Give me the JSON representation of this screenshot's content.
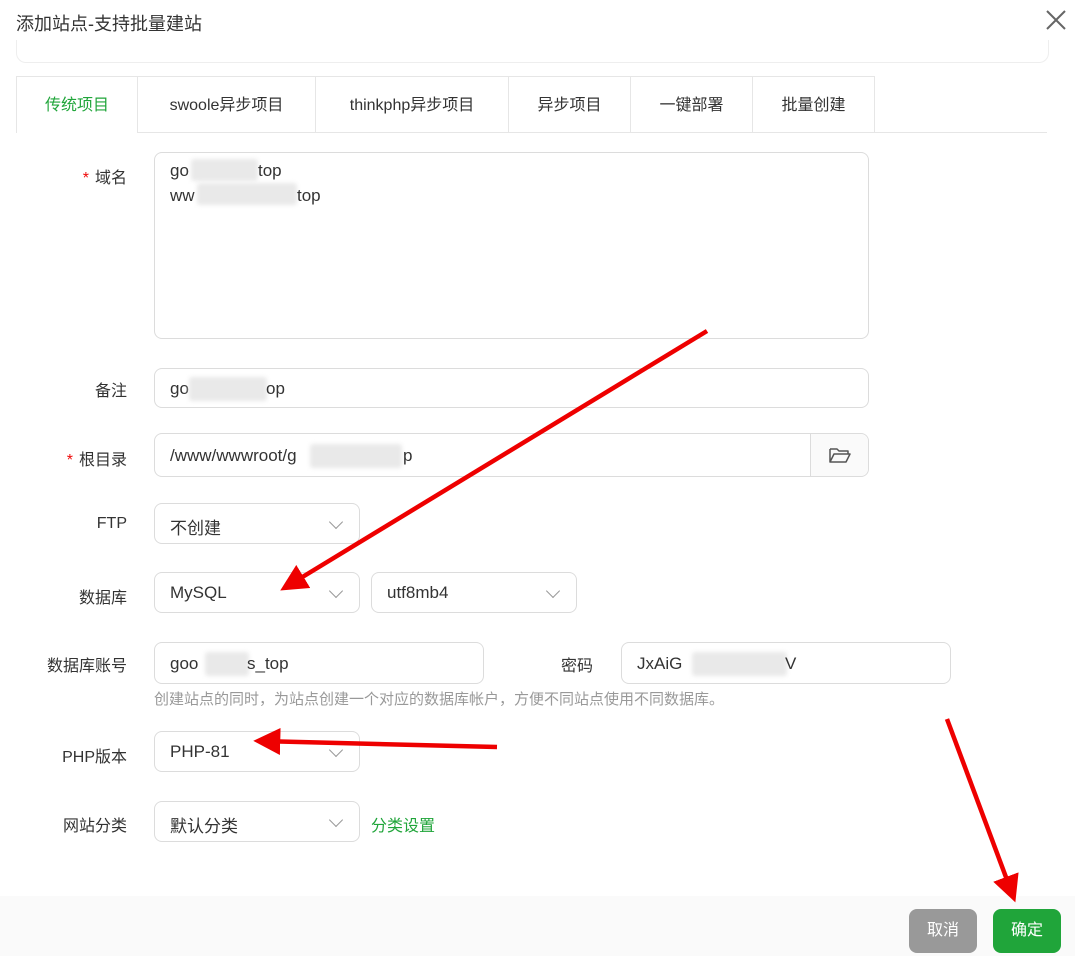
{
  "dialog": {
    "title": "添加站点-支持批量建站"
  },
  "tabs": [
    "传统项目",
    "swoole异步项目",
    "thinkphp异步项目",
    "异步项目",
    "一键部署",
    "批量创建"
  ],
  "form": {
    "domain": {
      "label": "域名",
      "lines": [
        "go",
        "top",
        "ww",
        "top"
      ]
    },
    "remark": {
      "label": "备注",
      "value_start": "go",
      "value_end": "op"
    },
    "root": {
      "label": "根目录",
      "value_start": "/www/wwwroot/g",
      "value_end": "p"
    },
    "ftp": {
      "label": "FTP",
      "value": "不创建"
    },
    "database": {
      "label": "数据库",
      "type": "MySQL",
      "charset": "utf8mb4"
    },
    "db_account": {
      "label": "数据库账号",
      "value_start": "goo",
      "value_end": "s_top"
    },
    "password": {
      "label": "密码",
      "value_start": "JxAiG",
      "value_end": "V"
    },
    "hint": "创建站点的同时，为站点创建一个对应的数据库帐户，方便不同站点使用不同数据库。",
    "php": {
      "label": "PHP版本",
      "value": "PHP-81"
    },
    "category": {
      "label": "网站分类",
      "value": "默认分类",
      "link": "分类设置"
    }
  },
  "footer": {
    "cancel": "取消",
    "confirm": "确定"
  },
  "colors": {
    "accent": "#20a53a",
    "annotation": "#ee0000",
    "cancel_bg": "#999999"
  }
}
